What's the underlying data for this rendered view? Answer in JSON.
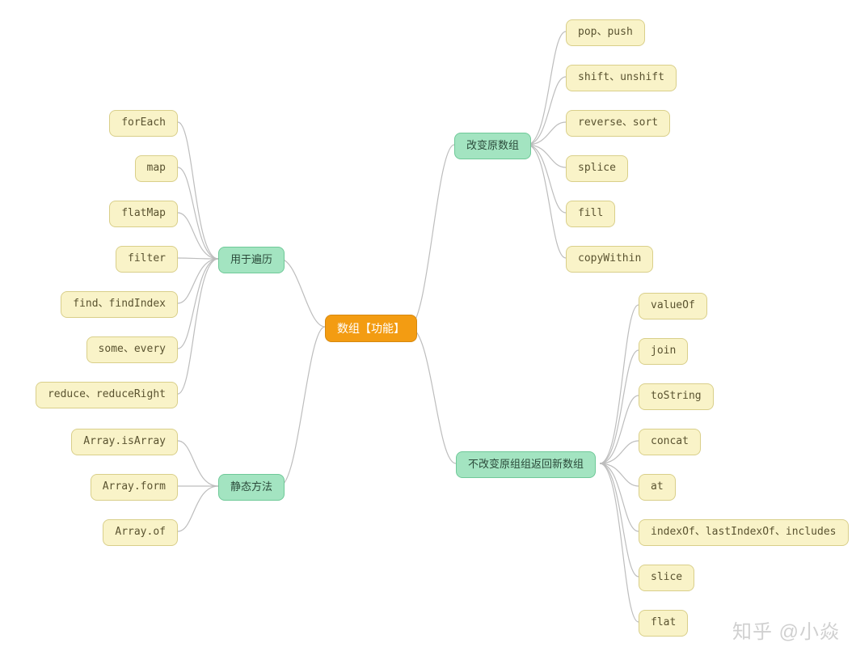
{
  "root": {
    "label": "数组【功能】"
  },
  "branches": {
    "iterate": {
      "label": "用于遍历"
    },
    "static": {
      "label": "静态方法"
    },
    "mutate": {
      "label": "改变原数组"
    },
    "nomutate": {
      "label": "不改变原组组返回新数组"
    }
  },
  "leaves": {
    "iterate": [
      "forEach",
      "map",
      "flatMap",
      "filter",
      "find、findIndex",
      "some、every",
      "reduce、reduceRight"
    ],
    "static": [
      "Array.isArray",
      "Array.form",
      "Array.of"
    ],
    "mutate": [
      "pop、push",
      "shift、unshift",
      "reverse、sort",
      "splice",
      "fill",
      "copyWithin"
    ],
    "nomutate": [
      "valueOf",
      "join",
      "toString",
      "concat",
      "at",
      "indexOf、lastIndexOf、includes",
      "slice",
      "flat"
    ]
  },
  "watermark": "知乎 @小焱",
  "colors": {
    "root_bg": "#f39c12",
    "branch_bg": "#a3e4c1",
    "leaf_bg": "#f9f3c8",
    "connector": "#bdbdbd"
  }
}
